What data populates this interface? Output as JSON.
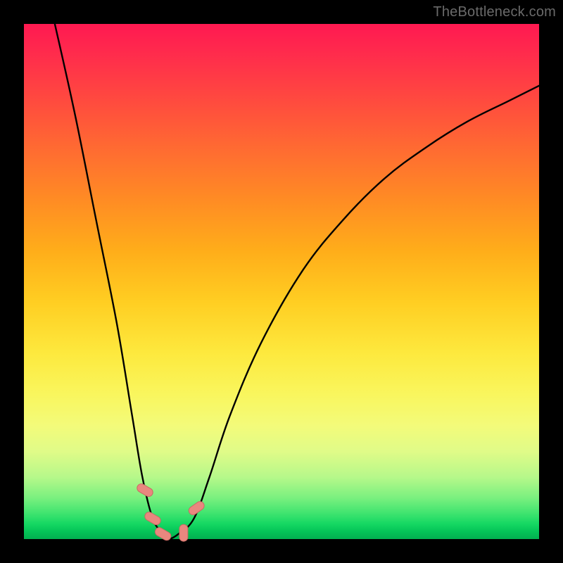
{
  "watermark": "TheBottleneck.com",
  "chart_data": {
    "type": "line",
    "title": "",
    "xlabel": "",
    "ylabel": "",
    "xlim": [
      0,
      100
    ],
    "ylim": [
      0,
      100
    ],
    "grid": false,
    "series": [
      {
        "name": "bottleneck-curve",
        "x": [
          6,
          10,
          14,
          18,
          21,
          23,
          25,
          27,
          28,
          30,
          33,
          36,
          40,
          46,
          54,
          62,
          70,
          78,
          86,
          94,
          100
        ],
        "values": [
          100,
          82,
          62,
          42,
          24,
          12,
          4,
          1,
          0,
          1,
          4,
          12,
          24,
          38,
          52,
          62,
          70,
          76,
          81,
          85,
          88
        ]
      }
    ],
    "markers": [
      {
        "name": "left-upper",
        "x": 23.5,
        "y": 9.5
      },
      {
        "name": "left-lower",
        "x": 25.0,
        "y": 4.0
      },
      {
        "name": "trough-left",
        "x": 27.0,
        "y": 1.0
      },
      {
        "name": "trough-right",
        "x": 31.0,
        "y": 1.2
      },
      {
        "name": "right-upper",
        "x": 33.5,
        "y": 6.0
      }
    ],
    "colors": {
      "curve": "#000000",
      "marker_fill": "#e9877f",
      "marker_stroke": "#c96a62"
    }
  }
}
